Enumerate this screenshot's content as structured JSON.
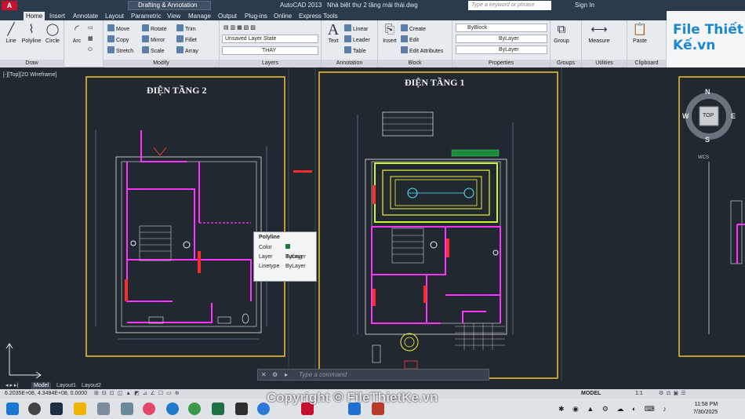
{
  "app": {
    "title": "AutoCAD 2013",
    "file": "Nhà biệt thự 2 tầng mái thái.dwg",
    "workspace": "Drafting & Annotation",
    "search_placeholder": "Type a keyword or phrase",
    "sign_in": "Sign In"
  },
  "tabs": [
    "Home",
    "Insert",
    "Annotate",
    "Layout",
    "Parametric",
    "View",
    "Manage",
    "Output",
    "Plug-ins",
    "Online",
    "Express Tools"
  ],
  "ribbon": {
    "draw": {
      "label": "Draw",
      "tools": [
        "Line",
        "Polyline",
        "Circle",
        "Arc"
      ]
    },
    "modify": {
      "label": "Modify",
      "tools": [
        "Move",
        "Rotate",
        "Trim",
        "Copy",
        "Mirror",
        "Fillet",
        "Stretch",
        "Scale",
        "Array"
      ]
    },
    "layers": {
      "label": "Layers",
      "state": "Unsaved Layer State",
      "current": "THAY"
    },
    "annotation": {
      "label": "Annotation",
      "text": "Text",
      "linear": "Linear",
      "leader": "Leader",
      "table": "Table"
    },
    "block": {
      "label": "Block",
      "insert": "Insert",
      "create": "Create",
      "edit": "Edit",
      "edit_attributes": "Edit Attributes"
    },
    "properties": {
      "label": "Properties",
      "color": "ByBlock",
      "linetype": "ByLayer",
      "lineweight": "ByLayer"
    },
    "groups": {
      "label": "Groups",
      "group": "Group"
    },
    "utilities": {
      "label": "Utilities",
      "measure": "Measure"
    },
    "clipboard": {
      "label": "Clipboard",
      "paste": "Paste"
    }
  },
  "brand": {
    "text": "File Thiết Kế.vn"
  },
  "viewport": {
    "label": "[-][Top][2D Wireframe]"
  },
  "drawing": {
    "floor2": "ĐIỆN TẦNG 2",
    "floor1": "ĐIỆN TẦNG 1"
  },
  "tooltip": {
    "title": "Polyline",
    "rows": [
      {
        "k": "Color",
        "v": "ByLayer"
      },
      {
        "k": "Layer",
        "v": "Tường"
      },
      {
        "k": "Linetype",
        "v": "ByLayer"
      }
    ]
  },
  "compass": {
    "n": "N",
    "s": "S",
    "e": "E",
    "w": "W",
    "top": "TOP",
    "wcs": "WCS"
  },
  "command": {
    "placeholder": "Type a command"
  },
  "layout_tabs": [
    "Model",
    "Layout1",
    "Layout2"
  ],
  "status": {
    "coords": "6.2035E+08, 4.3494E+08, 0.0000",
    "model": "MODEL",
    "scale": "1:1"
  },
  "clock": {
    "time": "11:58 PM",
    "date": "7/30/2025"
  },
  "watermark": "Copyright © FileThietKe.vn",
  "colors": {
    "accent": "#1b88d4",
    "canvas": "#212830",
    "magenta": "#ff33ff",
    "frame": "#f2c230"
  }
}
